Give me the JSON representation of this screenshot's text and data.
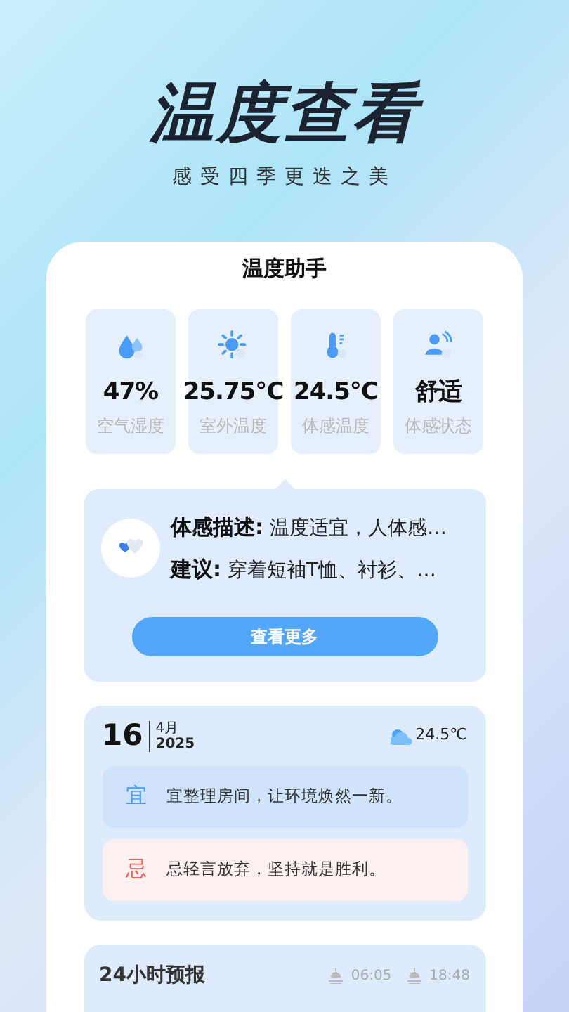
{
  "hero": {
    "title": "温度查看",
    "subtitle": "感受四季更迭之美"
  },
  "card": {
    "title": "温度助手",
    "stats": [
      {
        "kind": "humidity",
        "value": "47%",
        "label": "空气湿度"
      },
      {
        "kind": "outdoor",
        "value": "25.75℃",
        "label": "室外温度"
      },
      {
        "kind": "feel",
        "value": "24.5℃",
        "label": "体感温度"
      },
      {
        "kind": "status",
        "value": "舒适",
        "label": "体感状态"
      }
    ],
    "detail": {
      "lines": [
        {
          "label": "体感描述:",
          "text": "温度适宜，人体感…"
        },
        {
          "label": "建议:",
          "text": "穿着短袖T恤、衬衫、…"
        }
      ],
      "button": "查看更多"
    }
  },
  "almanac": {
    "day": "16",
    "month": "4月",
    "year": "2025",
    "temperature": "24.5℃",
    "items": [
      {
        "kind": "good",
        "mark": "宜",
        "text": "宜整理房间，让环境焕然一新。"
      },
      {
        "kind": "bad",
        "mark": "忌",
        "text": "忌轻言放弃，坚持就是胜利。"
      }
    ]
  },
  "forecast": {
    "title": "24小时预报",
    "sunrise": "06:05",
    "sunset": "18:48"
  }
}
